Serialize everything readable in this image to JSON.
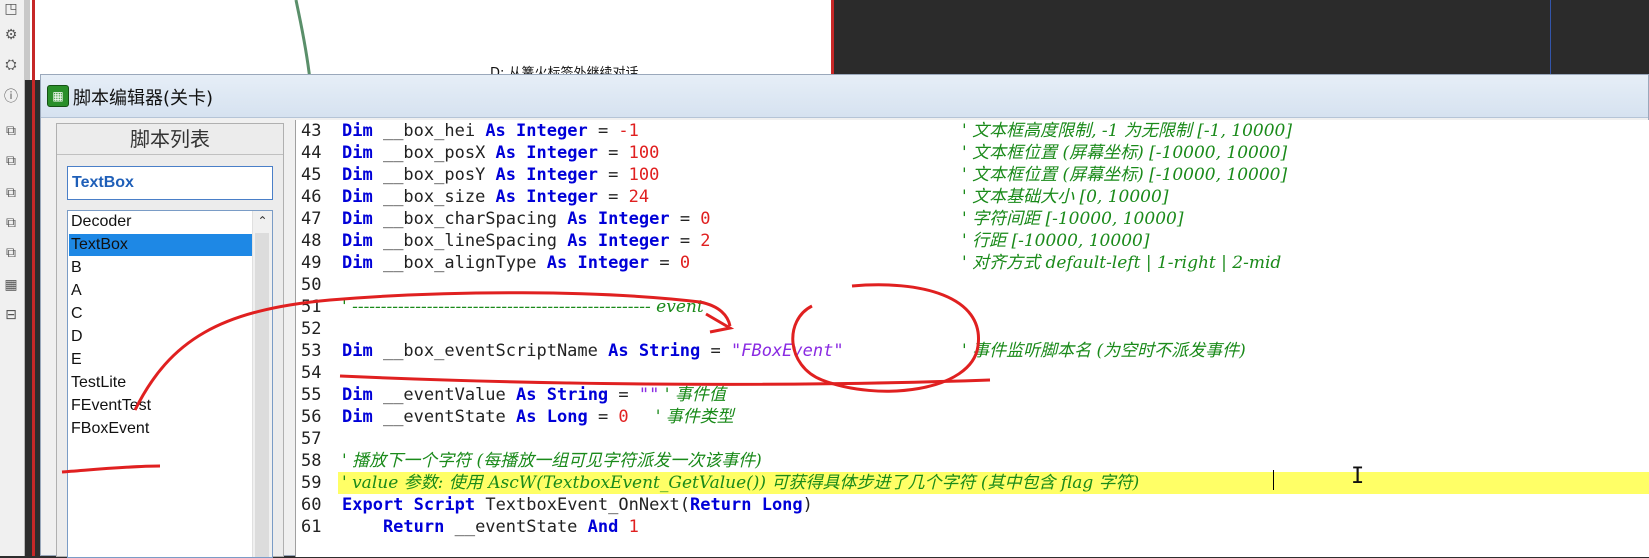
{
  "canvas": {
    "node_text": "D: 从篝火标签外继续对话"
  },
  "window": {
    "title": "脚本编辑器(关卡)",
    "icon": "app-icon"
  },
  "script_panel": {
    "title": "脚本列表",
    "search_value": "TextBox",
    "items": [
      {
        "label": "Decoder",
        "selected": false
      },
      {
        "label": "TextBox",
        "selected": true
      },
      {
        "label": "B",
        "selected": false
      },
      {
        "label": "A",
        "selected": false
      },
      {
        "label": "C",
        "selected": false
      },
      {
        "label": "D",
        "selected": false
      },
      {
        "label": "E",
        "selected": false
      },
      {
        "label": "TestLite",
        "selected": false
      },
      {
        "label": "FEventTest",
        "selected": false
      },
      {
        "label": "FBoxEvent",
        "selected": false
      }
    ]
  },
  "editor": {
    "line_numbers": [
      "43",
      "44",
      "45",
      "46",
      "47",
      "48",
      "49",
      "50",
      "51",
      "52",
      "53",
      "54",
      "55",
      "56",
      "57",
      "58",
      "59",
      "60",
      "61"
    ],
    "lines": {
      "l43": {
        "dim": "Dim",
        "name": " __box_hei ",
        "as": "As",
        "type": "Integer",
        "eq": " = ",
        "val": "-1",
        "comment": "' 文本框高度限制, -1 为无限制 [-1, 10000]"
      },
      "l44": {
        "dim": "Dim",
        "name": " __box_posX ",
        "as": "As",
        "type": "Integer",
        "eq": " = ",
        "val": "100",
        "comment": "' 文本框位置 (屏幕坐标) [-10000, 10000]"
      },
      "l45": {
        "dim": "Dim",
        "name": " __box_posY ",
        "as": "As",
        "type": "Integer",
        "eq": " = ",
        "val": "100",
        "comment": "' 文本框位置 (屏幕坐标) [-10000, 10000]"
      },
      "l46": {
        "dim": "Dim",
        "name": " __box_size ",
        "as": "As",
        "type": "Integer",
        "eq": " = ",
        "val": "24",
        "comment": "' 文本基础大小 [0, 10000]"
      },
      "l47": {
        "dim": "Dim",
        "name": " __box_charSpacing ",
        "as": "As",
        "type": "Integer",
        "eq": " = ",
        "val": "0",
        "comment": "' 字符间距 [-10000, 10000]"
      },
      "l48": {
        "dim": "Dim",
        "name": " __box_lineSpacing ",
        "as": "As",
        "type": "Integer",
        "eq": " = ",
        "val": "2",
        "comment": "' 行距 [-10000, 10000]"
      },
      "l49": {
        "dim": "Dim",
        "name": " __box_alignType ",
        "as": "As",
        "type": "Integer",
        "eq": " = ",
        "val": "0",
        "comment": "' 对齐方式 default-left | 1-right | 2-mid"
      },
      "l51": {
        "comment": "' ---------------------------------------------------- event"
      },
      "l53": {
        "dim": "Dim",
        "name": " __box_eventScriptName ",
        "as": "As",
        "type": "String",
        "eq": " = ",
        "val": "\"FBoxEvent\"",
        "comment": "' 事件监听脚本名 (为空时不派发事件)"
      },
      "l55": {
        "dim": "Dim",
        "name": " __eventValue ",
        "as": "As",
        "type": "String",
        "eq": " = ",
        "val": "\"\"",
        "comment": " ' 事件值"
      },
      "l56": {
        "dim": "Dim",
        "name": " __eventState ",
        "as": "As",
        "type": "Long",
        "eq": " = ",
        "val": "0",
        "comment": "     ' 事件类型"
      },
      "l58": {
        "comment": "' 播放下一个字符 (每播放一组可见字符派发一次该事件)"
      },
      "l59": {
        "comment": "' value 参数: 使用 AscW(TextboxEvent_GetValue()) 可获得具体步进了几个字符 (其中包含 flag 字符)"
      },
      "l60": {
        "export": "Export",
        "script": "Script",
        "name": " TextboxEvent_OnNext(",
        "ret": "Return",
        "type": "Long",
        "close": ")"
      },
      "l61": {
        "ret": "    Return",
        "name": " __eventState ",
        "and": "And",
        "val": " 1"
      }
    }
  },
  "colors": {
    "keyword": "#0000d8",
    "number": "#e02020",
    "string": "#8a2be2",
    "comment": "#1a8a1a",
    "highlight": "#ffff66",
    "selection": "#1e88e5",
    "annotation": "#e02020"
  }
}
